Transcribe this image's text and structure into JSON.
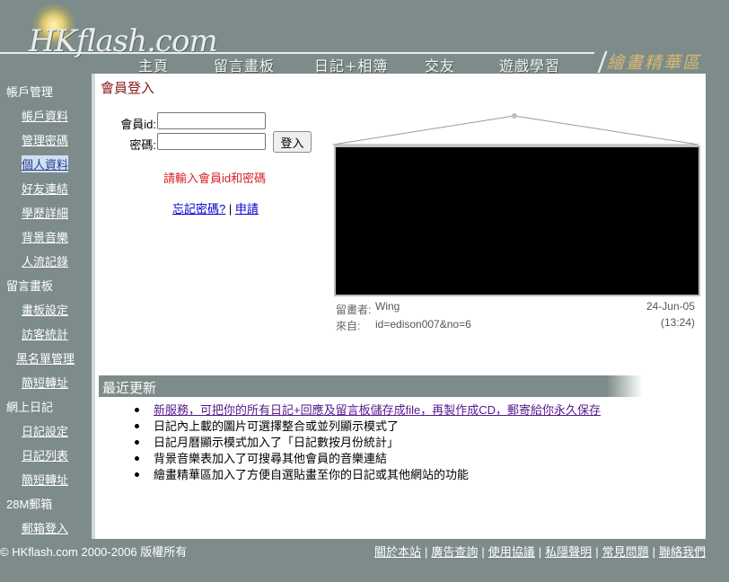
{
  "header": {
    "logo_text": "HKflash.com",
    "nav": [
      "主頁",
      "留言畫板",
      "日記+相簿",
      "交友",
      "遊戲學習"
    ],
    "brand_title": "繪畫精華區"
  },
  "sidebar": {
    "sections": [
      {
        "title": "帳戶管理",
        "items": [
          "帳戶資料",
          "管理密碼",
          "個人資料",
          "好友連結",
          "學歷詳細",
          "背景音樂",
          "人流記錄"
        ]
      },
      {
        "title": "留言畫板",
        "items": [
          "畫板設定",
          "訪客統計",
          "黑名單管理",
          "簡短轉址"
        ]
      },
      {
        "title": "網上日記",
        "items": [
          "日記設定",
          "日記列表",
          "簡短轉址"
        ]
      },
      {
        "title": "28M郵箱",
        "items": [
          "郵箱登入"
        ]
      }
    ],
    "selected_item": "個人資料"
  },
  "main": {
    "title": "會員登入",
    "login": {
      "id_label": "會員id:",
      "password_label": "密碼:",
      "id_value": "",
      "password_value": "",
      "submit_label": "登入",
      "warning": "請輸入會員id和密碼",
      "forgot_label": "忘記密碼?",
      "separator": "|",
      "register_label": "申請"
    },
    "board": {
      "author_label": "留畫者:",
      "author": "Wing",
      "from_label": "來自:",
      "from": "id=edison007&no=6",
      "date": "24-Jun-05",
      "time": "(13:24)"
    },
    "recent": {
      "title": "最近更新",
      "items": [
        "新服務，可把你的所有日記+回應及留言板儲存成file，再製作成CD，郵寄給你永久保存",
        "日記內上載的圖片可選擇整合或並列顯示模式了",
        "日記月曆顯示模式加入了「日記數按月份統計」",
        "背景音樂表加入了可搜尋其他會員的音樂連結",
        "繪畫精華區加入了方便自選貼畫至你的日記或其他網站的功能"
      ]
    }
  },
  "footer": {
    "copyright": "© HKflash.com 2000-2006 版權所有",
    "links": [
      "關於本站",
      "廣告查詢",
      "使用協議",
      "私隱聲明",
      "常見問題",
      "聯絡我們"
    ]
  },
  "colors": {
    "background": "#7d8c8a",
    "title_red": "#8b1a1a",
    "warning_red": "#d8222a",
    "brand_gold": "#d9b870"
  }
}
